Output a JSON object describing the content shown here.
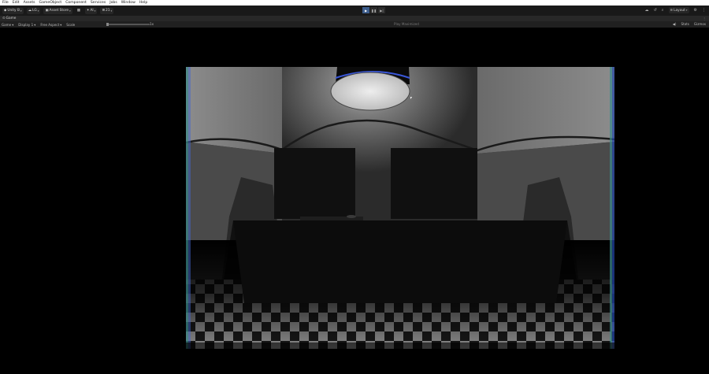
{
  "menubar": {
    "items": [
      "File",
      "Edit",
      "Assets",
      "GameObject",
      "Component",
      "Services",
      "Jobs",
      "Window",
      "Help"
    ]
  },
  "toolbar": {
    "account": "Unity B",
    "lighting": "LG",
    "asset_store": "Asset Store",
    "ai": "AI",
    "version": "21",
    "layout": "Layout"
  },
  "tab": {
    "label": "Game"
  },
  "game_toolbar": {
    "mode": "Game",
    "display": "Display 1",
    "aspect": "Free Aspect",
    "scale_label": "Scale",
    "scale_value": "1x",
    "play_focused": "Play Maximized",
    "stats": "Stats",
    "gizmos": "Gizmos"
  },
  "colors": {
    "menubar_bg": "#ffffff",
    "toolbar_bg": "#191919",
    "play_active": "#3d5d8c",
    "viewport_bg": "#000000"
  }
}
